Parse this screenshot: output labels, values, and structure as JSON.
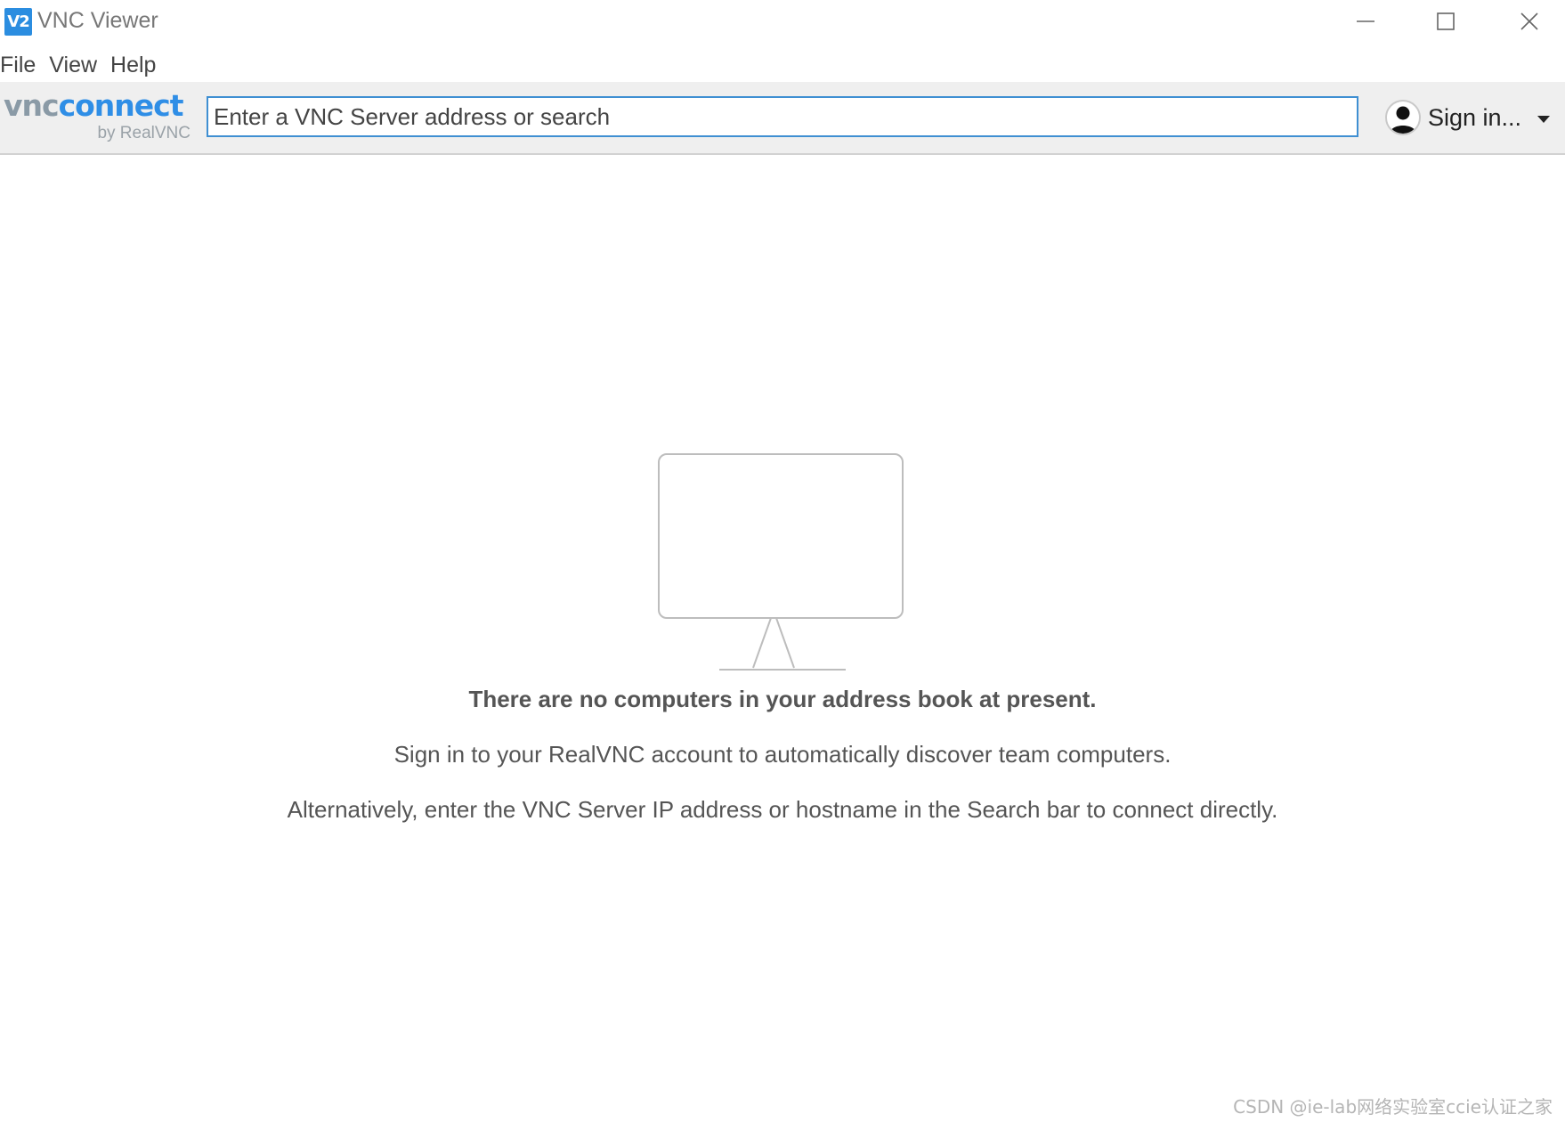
{
  "window": {
    "title": "VNC Viewer",
    "icon_label": "V2"
  },
  "menu": {
    "items": [
      "File",
      "View",
      "Help"
    ]
  },
  "toolbar": {
    "logo_main_1": "vnc",
    "logo_main_2": "connect",
    "logo_sub": "by RealVNC",
    "search_placeholder": "Enter a VNC Server address or search",
    "search_value": "",
    "signin_label": "Sign in..."
  },
  "empty_state": {
    "title": "There are no computers in your address book at present.",
    "line1": "Sign in to your RealVNC account to automatically discover team computers.",
    "line2": "Alternatively, enter the VNC Server IP address or hostname in the Search bar to connect directly."
  },
  "watermark": "CSDN @ie-lab网络实验室ccie认证之家",
  "colors": {
    "accent": "#2f8ee6",
    "input_border": "#3f8fd2",
    "toolbar_bg": "#efefef"
  },
  "icons": {
    "app": "vnc-viewer-app-icon",
    "minimize": "minimize-icon",
    "maximize": "maximize-icon",
    "close": "close-icon",
    "avatar": "user-avatar-icon",
    "dropdown": "chevron-down-icon",
    "empty": "monitor-icon"
  }
}
